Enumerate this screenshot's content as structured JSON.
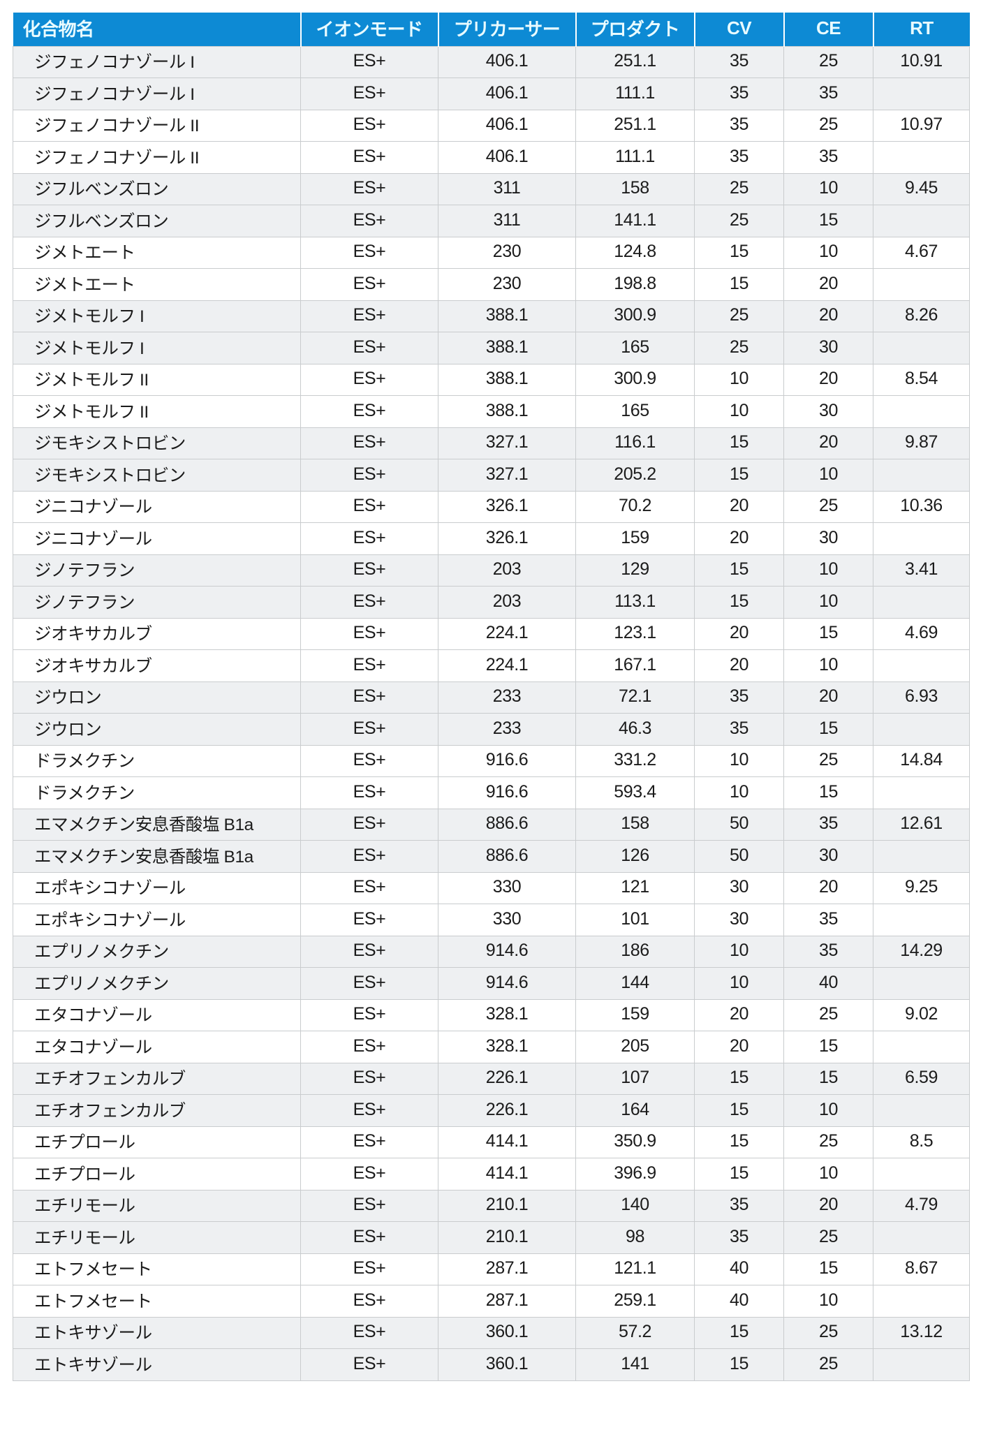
{
  "table": {
    "columns": [
      {
        "key": "name",
        "label": "化合物名",
        "align": "left"
      },
      {
        "key": "mode",
        "label": "イオンモード",
        "align": "center"
      },
      {
        "key": "precursor",
        "label": "プリカーサー",
        "align": "center"
      },
      {
        "key": "product",
        "label": "プロダクト",
        "align": "center"
      },
      {
        "key": "cv",
        "label": "CV",
        "align": "center"
      },
      {
        "key": "ce",
        "label": "CE",
        "align": "center"
      },
      {
        "key": "rt",
        "label": "RT",
        "align": "center"
      }
    ],
    "header_bg": "#0d8ad4",
    "header_fg": "#e9fbff",
    "stripe_bg": "#eef0f2",
    "plain_bg": "#ffffff",
    "border_color": "#c9ccce",
    "rows": [
      {
        "name": "ジフェノコナゾール I",
        "mode": "ES+",
        "precursor": "406.1",
        "product": "251.1",
        "cv": "35",
        "ce": "25",
        "rt": "10.91"
      },
      {
        "name": "ジフェノコナゾール I",
        "mode": "ES+",
        "precursor": "406.1",
        "product": "111.1",
        "cv": "35",
        "ce": "35",
        "rt": ""
      },
      {
        "name": "ジフェノコナゾール II",
        "mode": "ES+",
        "precursor": "406.1",
        "product": "251.1",
        "cv": "35",
        "ce": "25",
        "rt": "10.97"
      },
      {
        "name": "ジフェノコナゾール II",
        "mode": "ES+",
        "precursor": "406.1",
        "product": "111.1",
        "cv": "35",
        "ce": "35",
        "rt": ""
      },
      {
        "name": "ジフルベンズロン",
        "mode": "ES+",
        "precursor": "311",
        "product": "158",
        "cv": "25",
        "ce": "10",
        "rt": "9.45"
      },
      {
        "name": "ジフルベンズロン",
        "mode": "ES+",
        "precursor": "311",
        "product": "141.1",
        "cv": "25",
        "ce": "15",
        "rt": ""
      },
      {
        "name": "ジメトエート",
        "mode": "ES+",
        "precursor": "230",
        "product": "124.8",
        "cv": "15",
        "ce": "10",
        "rt": "4.67"
      },
      {
        "name": "ジメトエート",
        "mode": "ES+",
        "precursor": "230",
        "product": "198.8",
        "cv": "15",
        "ce": "20",
        "rt": ""
      },
      {
        "name": "ジメトモルフ I",
        "mode": "ES+",
        "precursor": "388.1",
        "product": "300.9",
        "cv": "25",
        "ce": "20",
        "rt": "8.26"
      },
      {
        "name": "ジメトモルフ I",
        "mode": "ES+",
        "precursor": "388.1",
        "product": "165",
        "cv": "25",
        "ce": "30",
        "rt": ""
      },
      {
        "name": "ジメトモルフ II",
        "mode": "ES+",
        "precursor": "388.1",
        "product": "300.9",
        "cv": "10",
        "ce": "20",
        "rt": "8.54"
      },
      {
        "name": "ジメトモルフ II",
        "mode": "ES+",
        "precursor": "388.1",
        "product": "165",
        "cv": "10",
        "ce": "30",
        "rt": ""
      },
      {
        "name": "ジモキシストロビン",
        "mode": "ES+",
        "precursor": "327.1",
        "product": "116.1",
        "cv": "15",
        "ce": "20",
        "rt": "9.87"
      },
      {
        "name": "ジモキシストロビン",
        "mode": "ES+",
        "precursor": "327.1",
        "product": "205.2",
        "cv": "15",
        "ce": "10",
        "rt": ""
      },
      {
        "name": "ジニコナゾール",
        "mode": "ES+",
        "precursor": "326.1",
        "product": "70.2",
        "cv": "20",
        "ce": "25",
        "rt": "10.36"
      },
      {
        "name": "ジニコナゾール",
        "mode": "ES+",
        "precursor": "326.1",
        "product": "159",
        "cv": "20",
        "ce": "30",
        "rt": ""
      },
      {
        "name": "ジノテフラン",
        "mode": "ES+",
        "precursor": "203",
        "product": "129",
        "cv": "15",
        "ce": "10",
        "rt": "3.41"
      },
      {
        "name": "ジノテフラン",
        "mode": "ES+",
        "precursor": "203",
        "product": "113.1",
        "cv": "15",
        "ce": "10",
        "rt": ""
      },
      {
        "name": "ジオキサカルブ",
        "mode": "ES+",
        "precursor": "224.1",
        "product": "123.1",
        "cv": "20",
        "ce": "15",
        "rt": "4.69"
      },
      {
        "name": "ジオキサカルブ",
        "mode": "ES+",
        "precursor": "224.1",
        "product": "167.1",
        "cv": "20",
        "ce": "10",
        "rt": ""
      },
      {
        "name": "ジウロン",
        "mode": "ES+",
        "precursor": "233",
        "product": "72.1",
        "cv": "35",
        "ce": "20",
        "rt": "6.93"
      },
      {
        "name": "ジウロン",
        "mode": "ES+",
        "precursor": "233",
        "product": "46.3",
        "cv": "35",
        "ce": "15",
        "rt": ""
      },
      {
        "name": "ドラメクチン",
        "mode": "ES+",
        "precursor": "916.6",
        "product": "331.2",
        "cv": "10",
        "ce": "25",
        "rt": "14.84"
      },
      {
        "name": "ドラメクチン",
        "mode": "ES+",
        "precursor": "916.6",
        "product": "593.4",
        "cv": "10",
        "ce": "15",
        "rt": ""
      },
      {
        "name": "エマメクチン安息香酸塩 B1a",
        "mode": "ES+",
        "precursor": "886.6",
        "product": "158",
        "cv": "50",
        "ce": "35",
        "rt": "12.61"
      },
      {
        "name": "エマメクチン安息香酸塩 B1a",
        "mode": "ES+",
        "precursor": "886.6",
        "product": "126",
        "cv": "50",
        "ce": "30",
        "rt": ""
      },
      {
        "name": "エポキシコナゾール",
        "mode": "ES+",
        "precursor": "330",
        "product": "121",
        "cv": "30",
        "ce": "20",
        "rt": "9.25"
      },
      {
        "name": "エポキシコナゾール",
        "mode": "ES+",
        "precursor": "330",
        "product": "101",
        "cv": "30",
        "ce": "35",
        "rt": ""
      },
      {
        "name": "エプリノメクチン",
        "mode": "ES+",
        "precursor": "914.6",
        "product": "186",
        "cv": "10",
        "ce": "35",
        "rt": "14.29"
      },
      {
        "name": "エプリノメクチン",
        "mode": "ES+",
        "precursor": "914.6",
        "product": "144",
        "cv": "10",
        "ce": "40",
        "rt": ""
      },
      {
        "name": "エタコナゾール",
        "mode": "ES+",
        "precursor": "328.1",
        "product": "159",
        "cv": "20",
        "ce": "25",
        "rt": "9.02"
      },
      {
        "name": "エタコナゾール",
        "mode": "ES+",
        "precursor": "328.1",
        "product": "205",
        "cv": "20",
        "ce": "15",
        "rt": ""
      },
      {
        "name": "エチオフェンカルブ",
        "mode": "ES+",
        "precursor": "226.1",
        "product": "107",
        "cv": "15",
        "ce": "15",
        "rt": "6.59"
      },
      {
        "name": "エチオフェンカルブ",
        "mode": "ES+",
        "precursor": "226.1",
        "product": "164",
        "cv": "15",
        "ce": "10",
        "rt": ""
      },
      {
        "name": "エチプロール",
        "mode": "ES+",
        "precursor": "414.1",
        "product": "350.9",
        "cv": "15",
        "ce": "25",
        "rt": "8.5"
      },
      {
        "name": "エチプロール",
        "mode": "ES+",
        "precursor": "414.1",
        "product": "396.9",
        "cv": "15",
        "ce": "10",
        "rt": ""
      },
      {
        "name": "エチリモール",
        "mode": "ES+",
        "precursor": "210.1",
        "product": "140",
        "cv": "35",
        "ce": "20",
        "rt": "4.79"
      },
      {
        "name": "エチリモール",
        "mode": "ES+",
        "precursor": "210.1",
        "product": "98",
        "cv": "35",
        "ce": "25",
        "rt": ""
      },
      {
        "name": "エトフメセート",
        "mode": "ES+",
        "precursor": "287.1",
        "product": "121.1",
        "cv": "40",
        "ce": "15",
        "rt": "8.67"
      },
      {
        "name": "エトフメセート",
        "mode": "ES+",
        "precursor": "287.1",
        "product": "259.1",
        "cv": "40",
        "ce": "10",
        "rt": ""
      },
      {
        "name": "エトキサゾール",
        "mode": "ES+",
        "precursor": "360.1",
        "product": "57.2",
        "cv": "15",
        "ce": "25",
        "rt": "13.12"
      },
      {
        "name": "エトキサゾール",
        "mode": "ES+",
        "precursor": "360.1",
        "product": "141",
        "cv": "15",
        "ce": "25",
        "rt": ""
      }
    ]
  }
}
